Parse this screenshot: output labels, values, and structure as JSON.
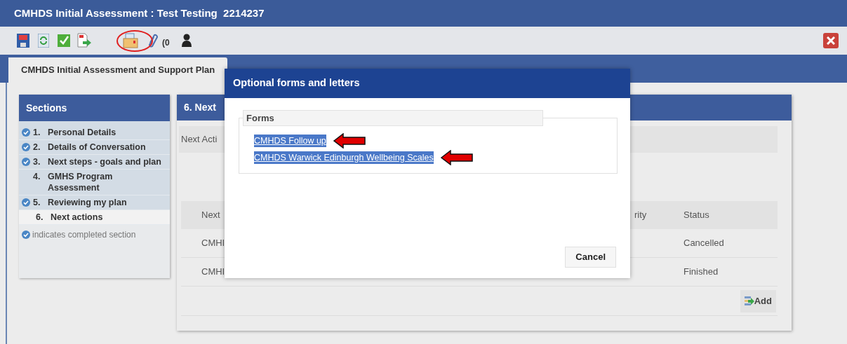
{
  "window": {
    "title": "CMHDS Initial Assessment : Test Testing  2214237"
  },
  "toolbar": {
    "attachment_count": "(0"
  },
  "tabs": [
    {
      "label": "CMHDS Initial Assessment and Support Plan",
      "selected": true
    }
  ],
  "sections": {
    "title": "Sections",
    "items": [
      {
        "number": "1.",
        "label": "Personal Details",
        "completed": true,
        "selected": false
      },
      {
        "number": "2.",
        "label": "Details of Conversation",
        "completed": true,
        "selected": false
      },
      {
        "number": "3.",
        "label": "Next steps - goals and plan",
        "completed": true,
        "selected": false
      },
      {
        "number": "4.",
        "label": "GMHS Program Assessment",
        "completed": false,
        "selected": false
      },
      {
        "number": "5.",
        "label": "Reviewing my plan",
        "completed": true,
        "selected": false
      },
      {
        "number": "6.",
        "label": "Next actions",
        "completed": false,
        "selected": true
      }
    ],
    "legend": "indicates completed section"
  },
  "main": {
    "title": "6. Next",
    "field_label": "Next Acti",
    "table": {
      "columns": [
        "Next",
        "rity",
        "Status"
      ],
      "rows": [
        [
          "CMHI",
          "Cancelled"
        ],
        [
          "CMHI",
          "Finished"
        ]
      ]
    },
    "add_button": "Add"
  },
  "dialog": {
    "title": "Optional forms and letters",
    "group": "Forms",
    "links": [
      "CMHDS Follow up",
      "CMHDS Warwick Edinburgh Wellbeing Scales"
    ],
    "cancel": "Cancel"
  }
}
